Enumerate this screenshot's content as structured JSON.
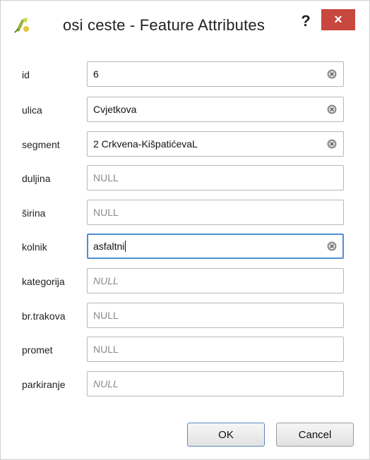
{
  "window": {
    "title": "osi ceste - Feature Attributes",
    "help_label": "?",
    "close_label": "×",
    "close_color": "#c8473e"
  },
  "fields": [
    {
      "label": "id",
      "value": "6",
      "has_value": true
    },
    {
      "label": "ulica",
      "value": "Cvjetkova",
      "has_value": true
    },
    {
      "label": "segment",
      "value": "2 Crkvena-KišpatićevaL",
      "has_value": true
    },
    {
      "label": "duljina",
      "value": "NULL",
      "has_value": false
    },
    {
      "label": "širina",
      "value": "NULL",
      "has_value": false
    },
    {
      "label": "kolnik",
      "value": "asfaltni",
      "has_value": true,
      "focused": true
    },
    {
      "label": "kategorija",
      "value": "NULL",
      "has_value": false,
      "italic": true
    },
    {
      "label": "br.trakova",
      "value": "NULL",
      "has_value": false
    },
    {
      "label": "promet",
      "value": "NULL",
      "has_value": false
    },
    {
      "label": "parkiranje",
      "value": "NULL",
      "has_value": false,
      "italic": true
    }
  ],
  "buttons": {
    "ok_label": "OK",
    "cancel_label": "Cancel"
  },
  "colors": {
    "focus_border": "#4e8fd6"
  }
}
